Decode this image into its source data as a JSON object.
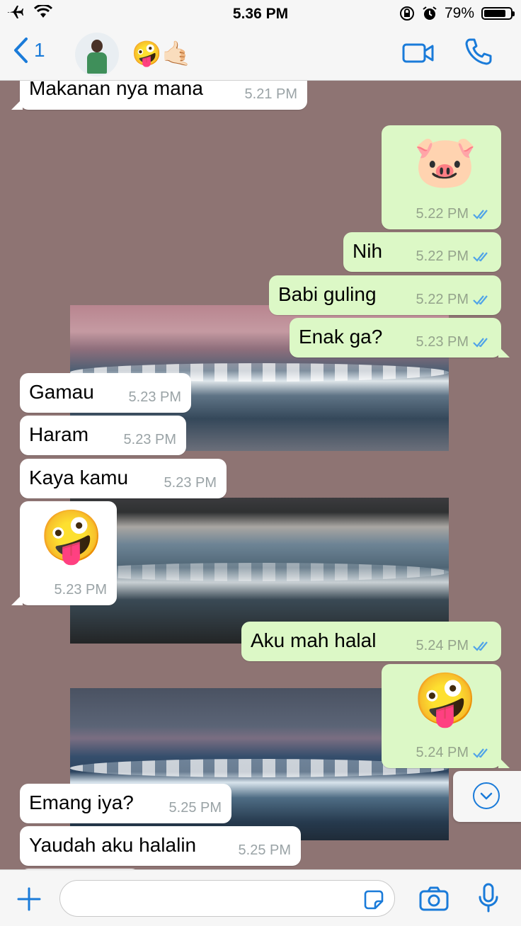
{
  "status_bar": {
    "time": "5.36 PM",
    "battery": "79%"
  },
  "header": {
    "back_count": "1",
    "contact_name": "🤪🤙🏻"
  },
  "messages": [
    {
      "dir": "in",
      "text": "Makanan nya mana",
      "time": "5.21 PM"
    },
    {
      "dir": "out",
      "text": "🐷",
      "time": "5.22 PM"
    },
    {
      "dir": "out",
      "text": "Nih",
      "time": "5.22 PM"
    },
    {
      "dir": "out",
      "text": "Babi guling",
      "time": "5.22 PM"
    },
    {
      "dir": "out",
      "text": "Enak ga?",
      "time": "5.23 PM"
    },
    {
      "dir": "in",
      "text": "Gamau",
      "time": "5.23 PM"
    },
    {
      "dir": "in",
      "text": "Haram",
      "time": "5.23 PM"
    },
    {
      "dir": "in",
      "text": "Kaya kamu",
      "time": "5.23 PM"
    },
    {
      "dir": "in",
      "text": "🤪",
      "time": "5.23 PM"
    },
    {
      "dir": "out",
      "text": "Aku mah halal",
      "time": "5.24 PM"
    },
    {
      "dir": "out",
      "text": "🤪",
      "time": "5.24 PM"
    },
    {
      "dir": "in",
      "text": "Emang iya?",
      "time": "5.25 PM"
    },
    {
      "dir": "in",
      "text": "Yaudah aku halalin",
      "time": "5.25 PM"
    }
  ],
  "colors": {
    "accent": "#1a7bd9",
    "outgoing_bubble": "#dcf8c6",
    "incoming_bubble": "#ffffff",
    "read_tick": "#4fa3e8"
  },
  "icons": [
    "airplane-icon",
    "wifi-icon",
    "lock-rotation-icon",
    "alarm-icon",
    "battery-icon",
    "back-chevron-icon",
    "video-call-icon",
    "phone-icon",
    "plus-icon",
    "sticker-icon",
    "camera-icon",
    "microphone-icon",
    "scroll-down-icon",
    "read-receipt-icon"
  ]
}
